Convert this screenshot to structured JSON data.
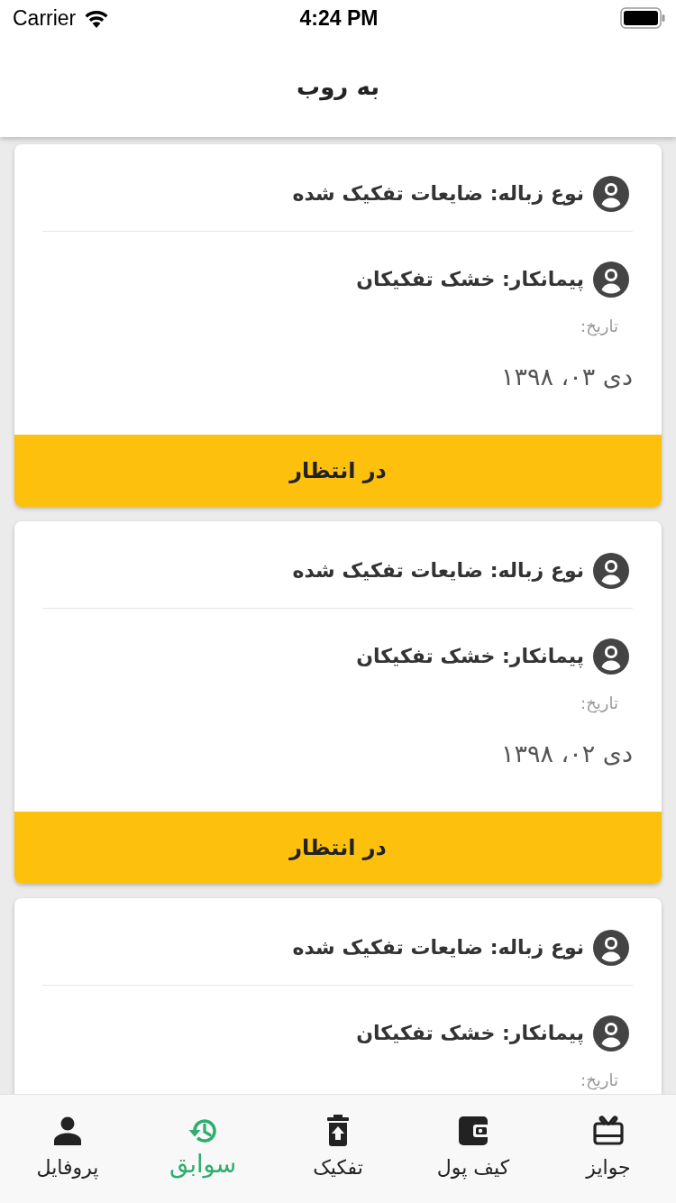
{
  "status_bar": {
    "carrier": "Carrier",
    "time": "4:24 PM"
  },
  "header": {
    "title": "به روب"
  },
  "records": [
    {
      "waste_type": "نوع زباله: ضایعات تفکیک شده",
      "contractor": "پیمانکار: خشک تفکیکان",
      "date_label": "تاریخ:",
      "date": "دی ۰۳، ۱۳۹۸",
      "status": "در انتظار"
    },
    {
      "waste_type": "نوع زباله: ضایعات تفکیک شده",
      "contractor": "پیمانکار: خشک تفکیکان",
      "date_label": "تاریخ:",
      "date": "دی ۰۲، ۱۳۹۸",
      "status": "در انتظار"
    },
    {
      "waste_type": "نوع زباله: ضایعات تفکیک شده",
      "contractor": "پیمانکار: خشک تفکیکان",
      "date_label": "تاریخ:"
    }
  ],
  "tab_bar": [
    {
      "label": "جوایز",
      "selected": false
    },
    {
      "label": "کیف پول",
      "selected": false
    },
    {
      "label": "تفکیک",
      "selected": false
    },
    {
      "label": "سوابق",
      "selected": true
    },
    {
      "label": "پروفایل",
      "selected": false
    }
  ]
}
